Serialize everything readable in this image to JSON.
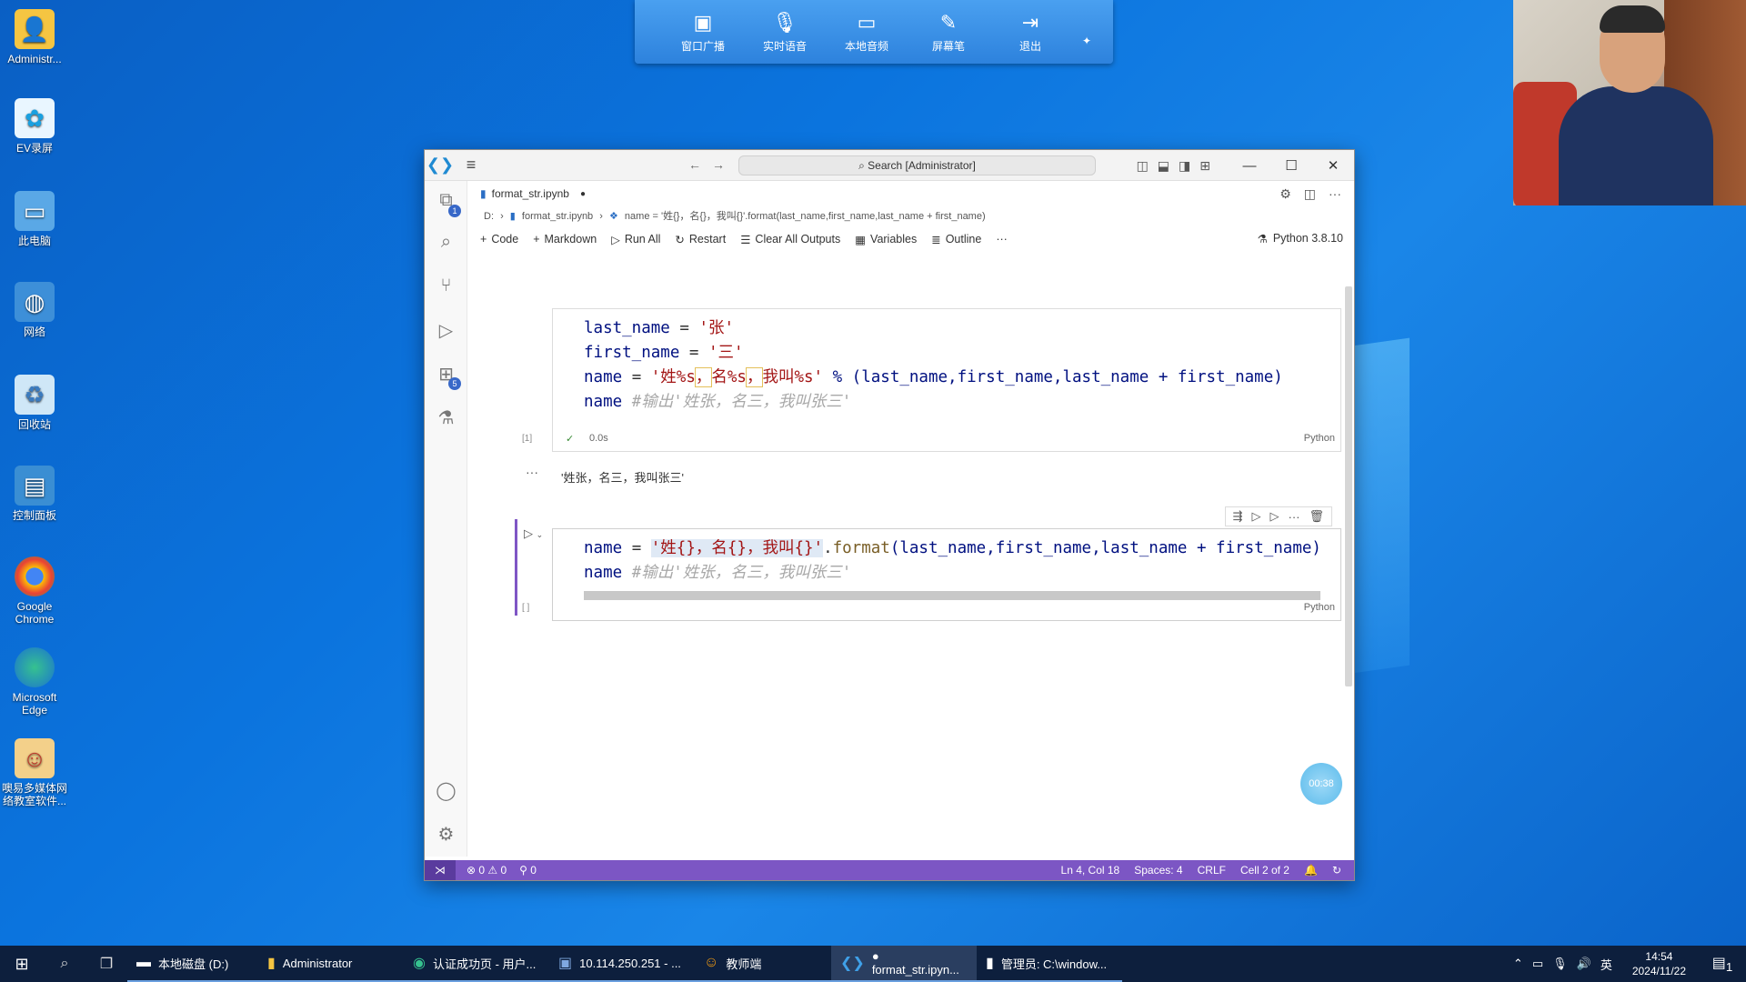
{
  "desktop": {
    "icons": [
      {
        "label": "Administr...",
        "icon": "folder-user-icon"
      },
      {
        "label": "EV录屏",
        "icon": "ev-recorder-icon"
      },
      {
        "label": "此电脑",
        "icon": "computer-icon"
      },
      {
        "label": "网络",
        "icon": "network-icon"
      },
      {
        "label": "回收站",
        "icon": "recycle-bin-icon"
      },
      {
        "label": "控制面板",
        "icon": "control-panel-icon"
      },
      {
        "label": "Google Chrome",
        "icon": "chrome-icon"
      },
      {
        "label": "Microsoft Edge",
        "icon": "edge-icon"
      },
      {
        "label": "噢易多媒体网络教室软件...",
        "icon": "classroom-software-icon"
      }
    ]
  },
  "broadcast_toolbar": {
    "items": [
      {
        "label": "窗口广播",
        "icon": "monitor-icon"
      },
      {
        "label": "实时语音",
        "icon": "microphone-icon"
      },
      {
        "label": "本地音频",
        "icon": "speaker-monitor-icon"
      },
      {
        "label": "屏幕笔",
        "icon": "pen-icon"
      },
      {
        "label": "退出",
        "icon": "exit-icon"
      }
    ]
  },
  "vscode": {
    "search_placeholder": "Search [Administrator]",
    "tab": {
      "title": "format_str.ipynb",
      "dirty": "●"
    },
    "breadcrumb": [
      "D:",
      "format_str.ipynb",
      "name = '姓{}，名{}，我叫{}'.format(last_name,first_name,last_name + first_name)"
    ],
    "notebook_toolbar": {
      "code": "Code",
      "markdown": "Markdown",
      "run_all": "Run All",
      "restart": "Restart",
      "clear": "Clear All Outputs",
      "variables": "Variables",
      "outline": "Outline",
      "more": "···",
      "kernel": "Python 3.8.10"
    },
    "cell1": {
      "line1": [
        "last_name",
        " = ",
        "'张'"
      ],
      "line2": [
        "first_name",
        " = ",
        "'三'"
      ],
      "line3_a": "name",
      "line3_b": " = ",
      "line3_s1": "'姓%s",
      "line3_s2": "，",
      "line3_s3": "名%s",
      "line3_s4": "，",
      "line3_s5": "我叫%s'",
      "line3_c": " % (last_name,first_name,last_name + first_name)",
      "line4_a": "name ",
      "line4_cm": "#输出'姓张，名三，我叫张三'",
      "exec": "[1]",
      "time": "0.0s",
      "lang": "Python",
      "output": "'姓张，名三，我叫张三'",
      "output_dots": "···"
    },
    "cell2": {
      "line1_a": "name",
      "line1_b": " = ",
      "line1_str": "'姓{}，名{}，我叫{}'",
      "line1_dot": ".",
      "line1_fn": "format",
      "line1_args": "(last_name,first_name,last_name + first_name)",
      "line2_a": "name ",
      "line2_cm": "#输出'姓张，名三，我叫张三'",
      "exec": "[ ]",
      "lang": "Python"
    },
    "timer": "00:38",
    "status": {
      "errors": "⊗ 0 ⚠ 0",
      "ports": "⚲ 0",
      "position": "Ln 4, Col 18",
      "spaces": "Spaces: 4",
      "eol": "CRLF",
      "cell": "Cell 2 of 2"
    }
  },
  "taskbar": {
    "apps": [
      {
        "label": "本地磁盘 (D:)",
        "icon": "drive-icon"
      },
      {
        "label": "Administrator",
        "icon": "folder-icon"
      },
      {
        "label": "认证成功页 - 用户...",
        "icon": "edge-icon"
      },
      {
        "label": "10.114.250.251 - ...",
        "icon": "remote-desktop-icon"
      },
      {
        "label": "教师端",
        "icon": "teacher-icon"
      },
      {
        "label": "● format_str.ipyn...",
        "icon": "vscode-icon"
      },
      {
        "label": "管理员: C:\\window...",
        "icon": "cmd-icon"
      }
    ],
    "ime": "英",
    "time": "14:54",
    "date": "2024/11/22",
    "notifications": "1"
  }
}
